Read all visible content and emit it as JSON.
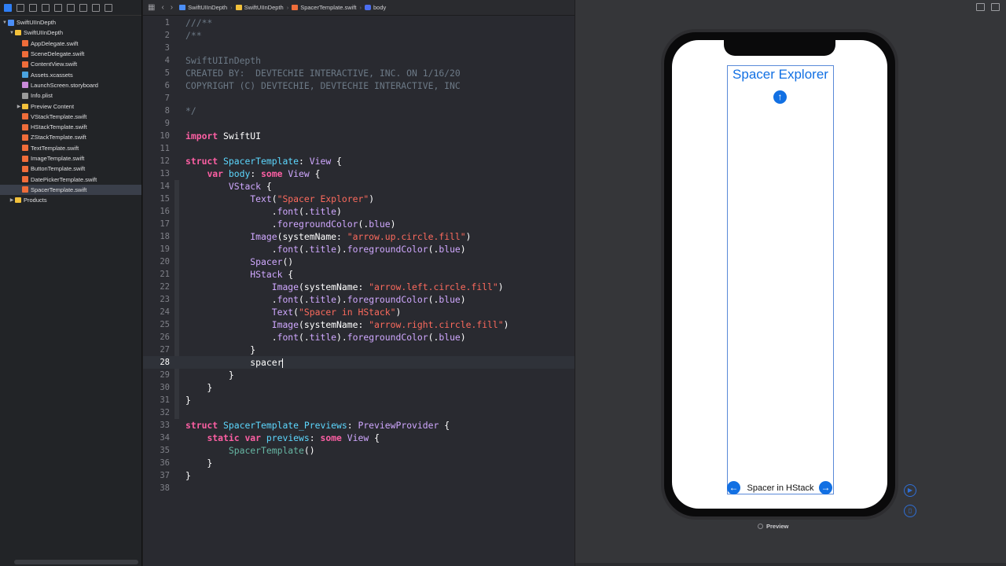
{
  "navigator": {
    "items": [
      {
        "label": "SwiftUIInDepth",
        "type": "proj",
        "indent": 0,
        "disclosure": "▼"
      },
      {
        "label": "SwiftUIInDepth",
        "type": "folder",
        "indent": 1,
        "disclosure": "▼"
      },
      {
        "label": "AppDelegate.swift",
        "type": "swift",
        "indent": 2
      },
      {
        "label": "SceneDelegate.swift",
        "type": "swift",
        "indent": 2
      },
      {
        "label": "ContentView.swift",
        "type": "swift",
        "indent": 2
      },
      {
        "label": "Assets.xcassets",
        "type": "assets",
        "indent": 2
      },
      {
        "label": "LaunchScreen.storyboard",
        "type": "sb",
        "indent": 2
      },
      {
        "label": "Info.plist",
        "type": "plist",
        "indent": 2
      },
      {
        "label": "Preview Content",
        "type": "folder",
        "indent": 2,
        "disclosure": "▶"
      },
      {
        "label": "VStackTemplate.swift",
        "type": "swift",
        "indent": 2
      },
      {
        "label": "HStackTemplate.swift",
        "type": "swift",
        "indent": 2
      },
      {
        "label": "ZStackTemplate.swift",
        "type": "swift",
        "indent": 2
      },
      {
        "label": "TextTemplate.swift",
        "type": "swift",
        "indent": 2
      },
      {
        "label": "ImageTemplate.swift",
        "type": "swift",
        "indent": 2
      },
      {
        "label": "ButtonTemplate.swift",
        "type": "swift",
        "indent": 2
      },
      {
        "label": "DatePickerTemplate.swift",
        "type": "swift",
        "indent": 2
      },
      {
        "label": "SpacerTemplate.swift",
        "type": "swift",
        "indent": 2,
        "selected": true
      },
      {
        "label": "Products",
        "type": "folder",
        "indent": 1,
        "disclosure": "▶"
      }
    ]
  },
  "jumpbar": {
    "crumbs": [
      "SwiftUIInDepth",
      "SwiftUIInDepth",
      "SpacerTemplate.swift",
      "body"
    ]
  },
  "editor": {
    "current_line": 28,
    "lines": [
      [
        [
          "cm",
          "///**"
        ]
      ],
      [
        [
          "cm",
          "/**"
        ]
      ],
      [
        [
          "cm",
          ""
        ]
      ],
      [
        [
          "cm",
          "SwiftUIInDepth"
        ]
      ],
      [
        [
          "cm",
          "CREATED BY:  DEVTECHIE INTERACTIVE, INC. ON 1/16/20"
        ]
      ],
      [
        [
          "cm",
          "COPYRIGHT (C) DEVTECHIE, DEVTECHIE INTERACTIVE, INC"
        ]
      ],
      [
        [
          "cm",
          ""
        ]
      ],
      [
        [
          "cm",
          "*/"
        ]
      ],
      [],
      [
        [
          "kw",
          "import"
        ],
        [
          "pl",
          " SwiftUI"
        ]
      ],
      [],
      [
        [
          "kw",
          "struct"
        ],
        [
          "pl",
          " "
        ],
        [
          "ty",
          "SpacerTemplate"
        ],
        [
          "pl",
          ": "
        ],
        [
          "tyo",
          "View"
        ],
        [
          "pl",
          " {"
        ]
      ],
      [
        [
          "pl",
          "    "
        ],
        [
          "kw",
          "var"
        ],
        [
          "pl",
          " "
        ],
        [
          "ty",
          "body"
        ],
        [
          "pl",
          ": "
        ],
        [
          "kw",
          "some"
        ],
        [
          "pl",
          " "
        ],
        [
          "tyo",
          "View"
        ],
        [
          "pl",
          " {"
        ]
      ],
      [
        [
          "pl",
          "        "
        ],
        [
          "tyo",
          "VStack"
        ],
        [
          "pl",
          " {"
        ]
      ],
      [
        [
          "pl",
          "            "
        ],
        [
          "tyo",
          "Text"
        ],
        [
          "pl",
          "("
        ],
        [
          "str",
          "\"Spacer Explorer\""
        ],
        [
          "pl",
          ")"
        ]
      ],
      [
        [
          "pl",
          "                ."
        ],
        [
          "tyo",
          "font"
        ],
        [
          "pl",
          "(."
        ],
        [
          "tyo",
          "title"
        ],
        [
          "pl",
          ")"
        ]
      ],
      [
        [
          "pl",
          "                ."
        ],
        [
          "tyo",
          "foregroundColor"
        ],
        [
          "pl",
          "(."
        ],
        [
          "tyo",
          "blue"
        ],
        [
          "pl",
          ")"
        ]
      ],
      [
        [
          "pl",
          "            "
        ],
        [
          "tyo",
          "Image"
        ],
        [
          "pl",
          "(systemName: "
        ],
        [
          "str",
          "\"arrow.up.circle.fill\""
        ],
        [
          "pl",
          ")"
        ]
      ],
      [
        [
          "pl",
          "                ."
        ],
        [
          "tyo",
          "font"
        ],
        [
          "pl",
          "(."
        ],
        [
          "tyo",
          "title"
        ],
        [
          "pl",
          ")."
        ],
        [
          "tyo",
          "foregroundColor"
        ],
        [
          "pl",
          "(."
        ],
        [
          "tyo",
          "blue"
        ],
        [
          "pl",
          ")"
        ]
      ],
      [
        [
          "pl",
          "            "
        ],
        [
          "tyo",
          "Spacer"
        ],
        [
          "pl",
          "()"
        ]
      ],
      [
        [
          "pl",
          "            "
        ],
        [
          "tyo",
          "HStack"
        ],
        [
          "pl",
          " {"
        ]
      ],
      [
        [
          "pl",
          "                "
        ],
        [
          "tyo",
          "Image"
        ],
        [
          "pl",
          "(systemName: "
        ],
        [
          "str",
          "\"arrow.left.circle.fill\""
        ],
        [
          "pl",
          ")"
        ]
      ],
      [
        [
          "pl",
          "                ."
        ],
        [
          "tyo",
          "font"
        ],
        [
          "pl",
          "(."
        ],
        [
          "tyo",
          "title"
        ],
        [
          "pl",
          ")."
        ],
        [
          "tyo",
          "foregroundColor"
        ],
        [
          "pl",
          "(."
        ],
        [
          "tyo",
          "blue"
        ],
        [
          "pl",
          ")"
        ]
      ],
      [
        [
          "pl",
          "                "
        ],
        [
          "tyo",
          "Text"
        ],
        [
          "pl",
          "("
        ],
        [
          "str",
          "\"Spacer in HStack\""
        ],
        [
          "pl",
          ")"
        ]
      ],
      [
        [
          "pl",
          "                "
        ],
        [
          "tyo",
          "Image"
        ],
        [
          "pl",
          "(systemName: "
        ],
        [
          "str",
          "\"arrow.right.circle.fill\""
        ],
        [
          "pl",
          ")"
        ]
      ],
      [
        [
          "pl",
          "                ."
        ],
        [
          "tyo",
          "font"
        ],
        [
          "pl",
          "(."
        ],
        [
          "tyo",
          "title"
        ],
        [
          "pl",
          ")."
        ],
        [
          "tyo",
          "foregroundColor"
        ],
        [
          "pl",
          "(."
        ],
        [
          "tyo",
          "blue"
        ],
        [
          "pl",
          ")"
        ]
      ],
      [
        [
          "pl",
          "            }"
        ]
      ],
      [
        [
          "pl",
          "            spacer"
        ]
      ],
      [
        [
          "pl",
          "        }"
        ]
      ],
      [
        [
          "pl",
          "    }"
        ]
      ],
      [
        [
          "pl",
          "}"
        ]
      ],
      [],
      [
        [
          "kw",
          "struct"
        ],
        [
          "pl",
          " "
        ],
        [
          "ty",
          "SpacerTemplate_Previews"
        ],
        [
          "pl",
          ": "
        ],
        [
          "tyo",
          "PreviewProvider"
        ],
        [
          "pl",
          " {"
        ]
      ],
      [
        [
          "pl",
          "    "
        ],
        [
          "kw",
          "static"
        ],
        [
          "pl",
          " "
        ],
        [
          "kw",
          "var"
        ],
        [
          "pl",
          " "
        ],
        [
          "ty",
          "previews"
        ],
        [
          "pl",
          ": "
        ],
        [
          "kw",
          "some"
        ],
        [
          "pl",
          " "
        ],
        [
          "tyo",
          "View"
        ],
        [
          "pl",
          " {"
        ]
      ],
      [
        [
          "pl",
          "        "
        ],
        [
          "fn",
          "SpacerTemplate"
        ],
        [
          "pl",
          "()"
        ]
      ],
      [
        [
          "pl",
          "    }"
        ]
      ],
      [
        [
          "pl",
          "}"
        ]
      ],
      []
    ]
  },
  "preview": {
    "title": "Spacer Explorer",
    "hstack_text": "Spacer in HStack",
    "label": "Preview",
    "accent_color": "#1270e3",
    "icons": [
      "arrow-up-circle-icon",
      "arrow-left-circle-icon",
      "arrow-right-circle-icon"
    ]
  }
}
